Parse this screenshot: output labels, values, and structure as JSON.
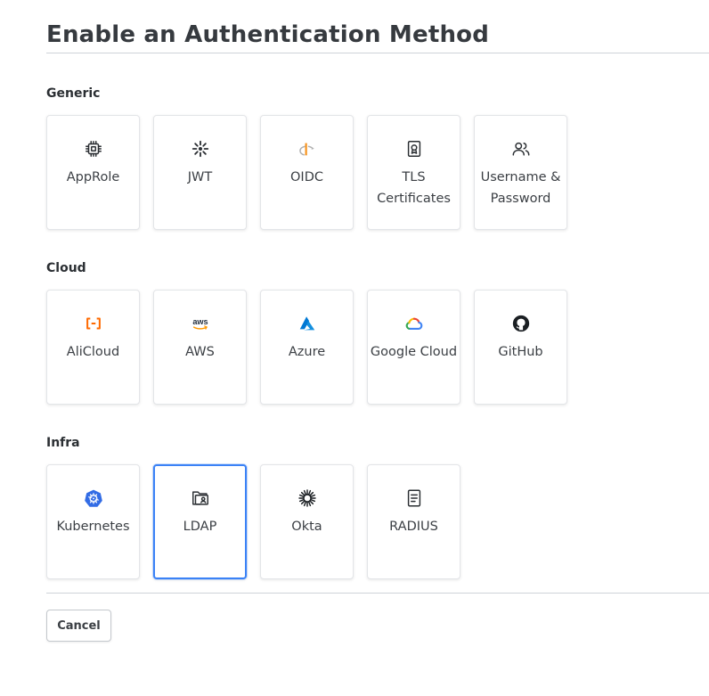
{
  "page_title": "Enable an Authentication Method",
  "sections": [
    {
      "label": "Generic",
      "items": [
        {
          "label": "AppRole",
          "icon": "chip-icon"
        },
        {
          "label": "JWT",
          "icon": "jwt-icon"
        },
        {
          "label": "OIDC",
          "icon": "openid-icon"
        },
        {
          "label": "TLS Certificates",
          "icon": "certificate-icon"
        },
        {
          "label": "Username & Password",
          "icon": "users-icon"
        }
      ]
    },
    {
      "label": "Cloud",
      "items": [
        {
          "label": "AliCloud",
          "icon": "alicloud-icon"
        },
        {
          "label": "AWS",
          "icon": "aws-icon"
        },
        {
          "label": "Azure",
          "icon": "azure-icon"
        },
        {
          "label": "Google Cloud",
          "icon": "google-cloud-icon"
        },
        {
          "label": "GitHub",
          "icon": "github-icon"
        }
      ]
    },
    {
      "label": "Infra",
      "items": [
        {
          "label": "Kubernetes",
          "icon": "kubernetes-icon"
        },
        {
          "label": "LDAP",
          "icon": "ldap-folder-icon",
          "selected": true
        },
        {
          "label": "Okta",
          "icon": "okta-icon"
        },
        {
          "label": "RADIUS",
          "icon": "radius-file-icon"
        }
      ]
    }
  ],
  "cancel_label": "Cancel",
  "colors": {
    "selected_border": "#3b82f6",
    "alicloud": "#ff6a00",
    "azure": "#0078d4",
    "kubernetes": "#326ce5",
    "openid": "#f7931e"
  }
}
